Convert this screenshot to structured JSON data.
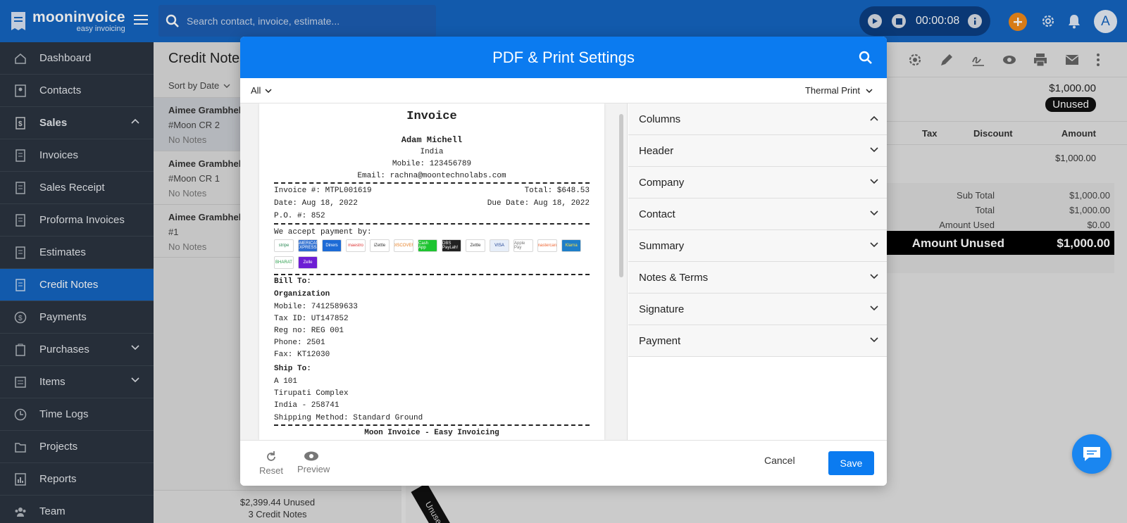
{
  "app": {
    "name": "mooninvoice",
    "tagline": "easy invoicing"
  },
  "search": {
    "placeholder": "Search contact, invoice, estimate..."
  },
  "timer": {
    "time": "00:00:08"
  },
  "user": {
    "initial": "A"
  },
  "sidebar": {
    "items": [
      {
        "label": "Dashboard"
      },
      {
        "label": "Contacts"
      },
      {
        "label": "Sales"
      },
      {
        "label": "Invoices"
      },
      {
        "label": "Sales Receipt"
      },
      {
        "label": "Proforma Invoices"
      },
      {
        "label": "Estimates"
      },
      {
        "label": "Credit Notes"
      },
      {
        "label": "Payments"
      },
      {
        "label": "Purchases"
      },
      {
        "label": "Items"
      },
      {
        "label": "Time Logs"
      },
      {
        "label": "Projects"
      },
      {
        "label": "Reports"
      },
      {
        "label": "Team"
      }
    ]
  },
  "list": {
    "title": "Credit Notes",
    "sort_label": "Sort by Date",
    "items": [
      {
        "name": "Aimee Grambhel",
        "number": "#Moon CR 2",
        "notes": "No Notes"
      },
      {
        "name": "Aimee Grambhel",
        "number": "#Moon CR 1",
        "notes": "No Notes"
      },
      {
        "name": "Aimee Grambhel",
        "number": "#1",
        "notes": "No Notes"
      }
    ],
    "footer_total": "$2,399.44 Unused",
    "footer_count": "3 Credit Notes"
  },
  "detail": {
    "amount": "$1,000.00",
    "status": "Unused",
    "columns": {
      "tax": "Tax",
      "discount": "Discount",
      "amount": "Amount"
    },
    "row_amount": "$1,000.00",
    "summary": {
      "subtotal_label": "Sub Total",
      "subtotal": "$1,000.00",
      "total_label": "Total",
      "total": "$1,000.00",
      "amount_used_label": "Amount Used",
      "amount_used": "$0.00",
      "amount_unused_label": "Amount Unused",
      "amount_unused": "$1,000.00"
    },
    "ribbon": "Unused"
  },
  "modal": {
    "title": "PDF & Print Settings",
    "filter": "All",
    "template": "Thermal Print",
    "sections": [
      {
        "label": "Columns",
        "expanded": true
      },
      {
        "label": "Header",
        "expanded": false
      },
      {
        "label": "Company",
        "expanded": false
      },
      {
        "label": "Contact",
        "expanded": false
      },
      {
        "label": "Summary",
        "expanded": false
      },
      {
        "label": "Notes & Terms",
        "expanded": false
      },
      {
        "label": "Signature",
        "expanded": false
      },
      {
        "label": "Payment",
        "expanded": false
      }
    ],
    "reset_label": "Reset",
    "preview_label": "Preview",
    "cancel_label": "Cancel",
    "save_label": "Save"
  },
  "receipt": {
    "title": "Invoice",
    "company_name": "Adam Michell",
    "country": "India",
    "mobile": "Mobile: 123456789",
    "email": "Email: rachna@moontechnolabs.com",
    "invoice_no": "Invoice #: MTPL001619",
    "total": "Total: $648.53",
    "date": "Date: Aug 18, 2022",
    "due_date": "Due Date: Aug 18, 2022",
    "po": "P.O. #: 852",
    "payment_heading": "We accept payment by:",
    "payment_methods": [
      "stripe",
      "AMERICAN EXPRESS",
      "Diners",
      "maestro",
      "iZettle",
      "DISCOVER",
      "Cash App",
      "DBS PayLah!",
      "Zettle",
      "VISA",
      "Apple Pay",
      "mastercard",
      "Klarna",
      "BHARAT",
      "Zelle"
    ],
    "bill_to": "Bill To:",
    "organization": "Organization",
    "bill_mobile": "Mobile: 7412589633",
    "tax_id": "Tax ID: UT147852",
    "reg_no": "Reg no: REG 001",
    "phone": "Phone: 2501",
    "fax": "Fax: KT12030",
    "ship_to": "Ship To:",
    "ship_line1": "A 101",
    "ship_line2": "Tirupati Complex",
    "ship_line3": "India - 258741",
    "shipping_method": "Shipping Method: Standard Ground",
    "footer_text": "Moon Invoice - Easy Invoicing"
  },
  "colors": {
    "primary": "#1565c0",
    "modal_header": "#0b7bf0",
    "sidebar": "#2b3440",
    "accent": "#f08a1a"
  }
}
